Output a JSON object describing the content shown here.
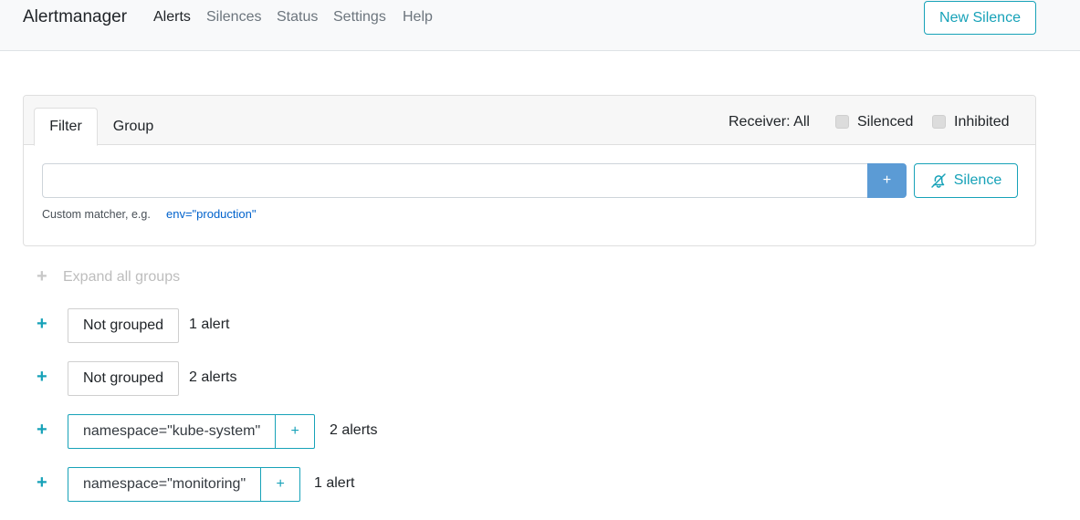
{
  "navbar": {
    "brand": "Alertmanager",
    "links": [
      "Alerts",
      "Silences",
      "Status",
      "Settings",
      "Help"
    ],
    "new_silence": "New Silence"
  },
  "filter_card": {
    "tabs": [
      "Filter",
      "Group"
    ],
    "receiver": "Receiver: All",
    "checkboxes": [
      {
        "label": "Silenced",
        "checked": false
      },
      {
        "label": "Inhibited",
        "checked": false
      }
    ],
    "input_value": "",
    "add_button": "+",
    "silence_button": "Silence",
    "hint": "Custom matcher, e.g.",
    "hint_example": "env=\"production\""
  },
  "groups": {
    "expand_all": "Expand all groups",
    "expand_icon": "+",
    "rows": [
      {
        "label": "Not grouped",
        "count": "1 alert",
        "matcher": false
      },
      {
        "label": "Not grouped",
        "count": "2 alerts",
        "matcher": false
      },
      {
        "label": "namespace=\"kube-system\"",
        "count": "2 alerts",
        "matcher": true,
        "add": "+"
      },
      {
        "label": "namespace=\"monitoring\"",
        "count": "1 alert",
        "matcher": true,
        "add": "+"
      }
    ]
  },
  "colors": {
    "accent": "#17a2b8",
    "primary_button": "#5b9bd5",
    "link": "#0062cc",
    "muted": "#6c757d"
  }
}
